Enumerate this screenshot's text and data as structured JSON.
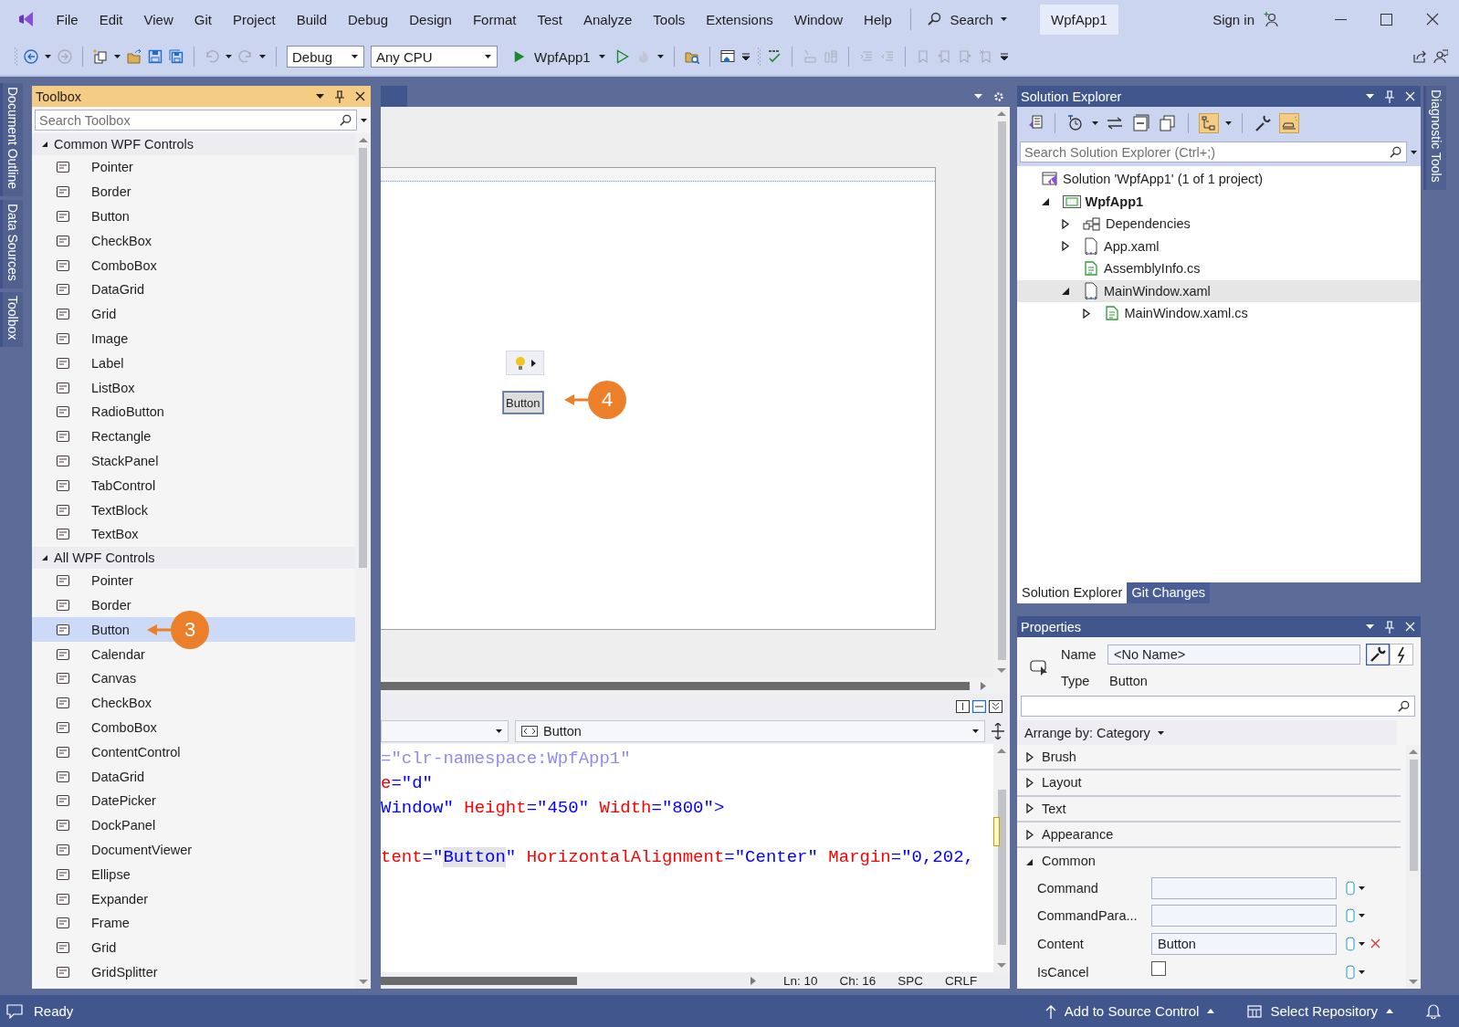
{
  "menu_bar": {
    "items": [
      "File",
      "Edit",
      "View",
      "Git",
      "Project",
      "Build",
      "Debug",
      "Design",
      "Format",
      "Test",
      "Analyze",
      "Tools",
      "Extensions",
      "Window",
      "Help"
    ],
    "search": "Search",
    "solution_name": "WpfApp1",
    "sign_in": "Sign in"
  },
  "toolbar": {
    "configuration": "Debug",
    "platform": "Any CPU",
    "start_target": "WpfApp1"
  },
  "left_side_tabs": [
    {
      "label": "Document Outline"
    },
    {
      "label": "Data Sources"
    },
    {
      "label": "Toolbox"
    }
  ],
  "toolbox": {
    "title": "Toolbox",
    "search": {
      "placeholder": "Search Toolbox"
    },
    "groups": [
      {
        "label": "Common WPF Controls",
        "expanded": true,
        "items": [
          {
            "label": "Pointer",
            "selected": false
          },
          {
            "label": "Border",
            "selected": false
          },
          {
            "label": "Button",
            "selected": false
          },
          {
            "label": "CheckBox",
            "selected": false
          },
          {
            "label": "ComboBox",
            "selected": false
          },
          {
            "label": "DataGrid",
            "selected": false
          },
          {
            "label": "Grid",
            "selected": false
          },
          {
            "label": "Image",
            "selected": false
          },
          {
            "label": "Label",
            "selected": false
          },
          {
            "label": "ListBox",
            "selected": false
          },
          {
            "label": "RadioButton",
            "selected": false
          },
          {
            "label": "Rectangle",
            "selected": false
          },
          {
            "label": "StackPanel",
            "selected": false
          },
          {
            "label": "TabControl",
            "selected": false
          },
          {
            "label": "TextBlock",
            "selected": false
          },
          {
            "label": "TextBox",
            "selected": false
          }
        ]
      },
      {
        "label": "All WPF Controls",
        "expanded": true,
        "items": [
          {
            "label": "Pointer",
            "selected": false
          },
          {
            "label": "Border",
            "selected": false
          },
          {
            "label": "Button",
            "selected": true,
            "callout": "3"
          },
          {
            "label": "Calendar",
            "selected": false
          },
          {
            "label": "Canvas",
            "selected": false
          },
          {
            "label": "CheckBox",
            "selected": false
          },
          {
            "label": "ComboBox",
            "selected": false
          },
          {
            "label": "ContentControl",
            "selected": false
          },
          {
            "label": "DataGrid",
            "selected": false
          },
          {
            "label": "DatePicker",
            "selected": false
          },
          {
            "label": "DockPanel",
            "selected": false
          },
          {
            "label": "DocumentViewer",
            "selected": false
          },
          {
            "label": "Ellipse",
            "selected": false
          },
          {
            "label": "Expander",
            "selected": false
          },
          {
            "label": "Frame",
            "selected": false
          },
          {
            "label": "Grid",
            "selected": false
          },
          {
            "label": "GridSplitter",
            "selected": false
          }
        ]
      }
    ]
  },
  "designer": {
    "element": {
      "content": "Button",
      "callout": "4"
    }
  },
  "xaml_editor": {
    "element_dropdown": "Button",
    "lines": [
      {
        "tokens": [
          {
            "text": "=\"clr-namespace:WpfApp1\"",
            "kind": "faded"
          }
        ]
      },
      {
        "tokens": [
          {
            "text": "e",
            "kind": "attr"
          },
          {
            "text": "=\"d\"",
            "kind": "value"
          }
        ]
      },
      {
        "tokens": [
          {
            "text": "Window\"",
            "kind": "value"
          },
          {
            "text": " Height",
            "kind": "attr"
          },
          {
            "text": "=\"450\"",
            "kind": "value"
          },
          {
            "text": " Width",
            "kind": "attr"
          },
          {
            "text": "=\"800\">",
            "kind": "value"
          }
        ]
      },
      {
        "kind": "blank"
      },
      {
        "tokens": [
          {
            "text": "tent",
            "kind": "attr"
          },
          {
            "text": "=\"",
            "kind": "value"
          },
          {
            "text": "Button",
            "kind": "highlight"
          },
          {
            "text": "\"",
            "kind": "value"
          },
          {
            "text": " HorizontalAlignment",
            "kind": "attr"
          },
          {
            "text": "=\"Center\"",
            "kind": "value"
          },
          {
            "text": " Margin",
            "kind": "attr"
          },
          {
            "text": "=\"0,202,",
            "kind": "value"
          }
        ]
      }
    ],
    "position": {
      "line": "Ln: 10",
      "column": "Ch: 16",
      "whitespace": "SPC",
      "line_ending": "CRLF"
    }
  },
  "solution_explorer": {
    "title": "Solution Explorer",
    "search": {
      "placeholder": "Search Solution Explorer (Ctrl+;)"
    },
    "tree": [
      {
        "label": "Solution 'WpfApp1' (1 of 1 project)",
        "kind": "solution",
        "selected": false,
        "children": [
          {
            "label": "WpfApp1",
            "kind": "project",
            "expanded": true,
            "selected": false,
            "children": [
              {
                "label": "Dependencies",
                "kind": "dependencies",
                "expanded": false,
                "selected": false
              },
              {
                "label": "App.xaml",
                "kind": "xaml",
                "expanded": false,
                "selected": false
              },
              {
                "label": "AssemblyInfo.cs",
                "kind": "code",
                "selected": false
              },
              {
                "label": "MainWindow.xaml",
                "kind": "xaml",
                "expanded": true,
                "selected": true,
                "children": [
                  {
                    "label": "MainWindow.xaml.cs",
                    "kind": "code",
                    "expanded": false,
                    "selected": false
                  }
                ]
              }
            ]
          }
        ]
      }
    ],
    "tabs": [
      {
        "label": "Solution Explorer",
        "selected": true
      },
      {
        "label": "Git Changes",
        "selected": false
      }
    ]
  },
  "properties": {
    "title": "Properties",
    "name": {
      "label": "Name",
      "value": "<No Name>"
    },
    "type": {
      "label": "Type",
      "value": "Button"
    },
    "arrange_by": "Arrange by: Category",
    "categories": [
      {
        "label": "Brush",
        "expanded": false
      },
      {
        "label": "Layout",
        "expanded": false
      },
      {
        "label": "Text",
        "expanded": false
      },
      {
        "label": "Appearance",
        "expanded": false
      },
      {
        "label": "Common",
        "expanded": true,
        "properties": [
          {
            "name": "Command",
            "kind": "text",
            "local_value": false
          },
          {
            "name": "CommandPara...",
            "kind": "text",
            "local_value": false
          },
          {
            "name": "Content",
            "kind": "text",
            "value": "Button",
            "local_value": true
          },
          {
            "name": "IsCancel",
            "kind": "checkbox",
            "checked": false,
            "local_value": false
          }
        ]
      }
    ]
  },
  "right_side_tabs": [
    {
      "label": "Diagnostic Tools"
    }
  ],
  "status_bar": {
    "message": "Ready",
    "source_control": "Add to Source Control",
    "repository": "Select Repository"
  }
}
